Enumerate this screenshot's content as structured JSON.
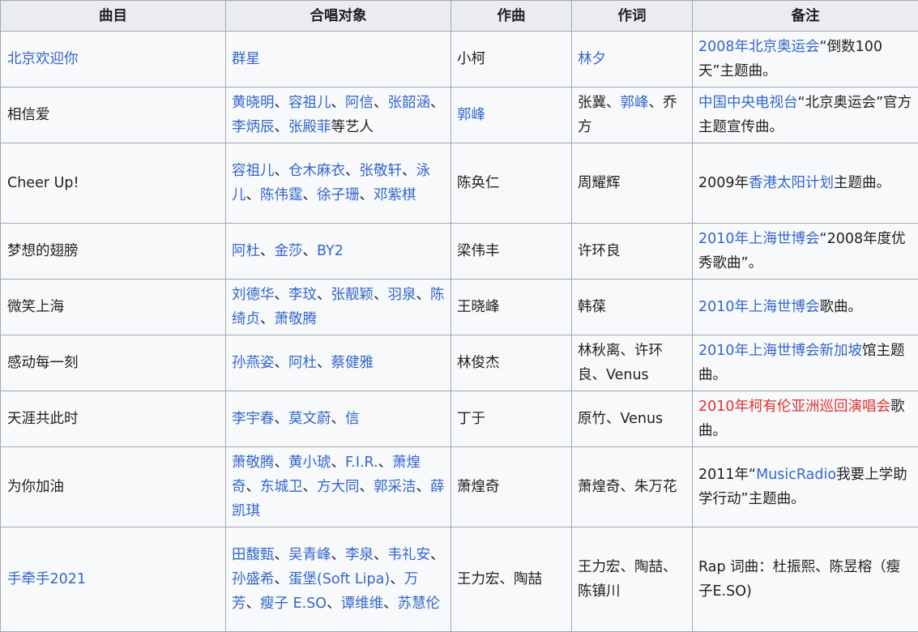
{
  "table": {
    "headers": [
      "曲目",
      "合唱对象",
      "作曲",
      "作词",
      "备注"
    ],
    "rows": [
      {
        "title": [
          {
            "t": "北京欢迎你",
            "link": true
          }
        ],
        "singers": [
          {
            "t": "群星",
            "link": true
          }
        ],
        "composer": [
          {
            "t": "小柯"
          }
        ],
        "lyricist": [
          {
            "t": "林夕",
            "link": true
          }
        ],
        "note": [
          {
            "t": "2008年北京奥运会",
            "link": true
          },
          {
            "t": "“倒数100天”主题曲。"
          }
        ]
      },
      {
        "title": [
          {
            "t": "相信爱"
          }
        ],
        "singers": [
          {
            "t": "黄晓明",
            "link": true
          },
          {
            "t": "、"
          },
          {
            "t": "容祖儿",
            "link": true
          },
          {
            "t": "、"
          },
          {
            "t": "阿信",
            "link": true
          },
          {
            "t": "、"
          },
          {
            "t": "张韶涵",
            "link": true
          },
          {
            "t": "、"
          },
          {
            "t": "李炳辰",
            "link": true
          },
          {
            "t": "、"
          },
          {
            "t": "张殿菲",
            "link": true
          },
          {
            "t": "等艺人"
          }
        ],
        "composer": [
          {
            "t": "郭峰",
            "link": true
          }
        ],
        "lyricist": [
          {
            "t": "张冀、"
          },
          {
            "t": "郭峰",
            "link": true
          },
          {
            "t": "、乔方"
          }
        ],
        "note": [
          {
            "t": "中国中央电视台",
            "link": true
          },
          {
            "t": "“北京奥运会”官方主题宣传曲。"
          }
        ]
      },
      {
        "title": [
          {
            "t": "Cheer Up!"
          }
        ],
        "singers": [
          {
            "t": "容祖儿",
            "link": true
          },
          {
            "t": "、"
          },
          {
            "t": "仓木麻衣",
            "link": true
          },
          {
            "t": "、"
          },
          {
            "t": "张敬轩",
            "link": true
          },
          {
            "t": "、"
          },
          {
            "t": "泳儿",
            "link": true
          },
          {
            "t": "、"
          },
          {
            "t": "陈伟霆",
            "link": true
          },
          {
            "t": "、"
          },
          {
            "t": "徐子珊",
            "link": true
          },
          {
            "t": "、"
          },
          {
            "t": "邓紫棋",
            "link": true
          }
        ],
        "composer": [
          {
            "t": "陈奂仁"
          }
        ],
        "lyricist": [
          {
            "t": "周耀辉"
          }
        ],
        "note": [
          {
            "t": "2009年"
          },
          {
            "t": "香港太阳计划",
            "link": true
          },
          {
            "t": "主题曲。"
          }
        ]
      },
      {
        "title": [
          {
            "t": "梦想的翅膀"
          }
        ],
        "singers": [
          {
            "t": "阿杜",
            "link": true
          },
          {
            "t": "、"
          },
          {
            "t": "金莎",
            "link": true
          },
          {
            "t": "、"
          },
          {
            "t": "BY2",
            "link": true
          }
        ],
        "composer": [
          {
            "t": "梁伟丰"
          }
        ],
        "lyricist": [
          {
            "t": "许环良"
          }
        ],
        "note": [
          {
            "t": "2010年上海世博会",
            "link": true
          },
          {
            "t": "“2008年度优秀歌曲”。"
          }
        ]
      },
      {
        "title": [
          {
            "t": "微笑上海"
          }
        ],
        "singers": [
          {
            "t": "刘德华",
            "link": true
          },
          {
            "t": "、"
          },
          {
            "t": "李玟",
            "link": true
          },
          {
            "t": "、"
          },
          {
            "t": "张靓颖",
            "link": true
          },
          {
            "t": "、"
          },
          {
            "t": "羽泉",
            "link": true
          },
          {
            "t": "、"
          },
          {
            "t": "陈绮贞",
            "link": true
          },
          {
            "t": "、"
          },
          {
            "t": "萧敬腾",
            "link": true
          }
        ],
        "composer": [
          {
            "t": "王晓峰"
          }
        ],
        "lyricist": [
          {
            "t": "韩葆"
          }
        ],
        "note": [
          {
            "t": "2010年上海世博会",
            "link": true
          },
          {
            "t": "歌曲。"
          }
        ]
      },
      {
        "title": [
          {
            "t": "感动每一刻"
          }
        ],
        "singers": [
          {
            "t": "孙燕姿",
            "link": true
          },
          {
            "t": "、"
          },
          {
            "t": "阿杜",
            "link": true
          },
          {
            "t": "、"
          },
          {
            "t": "蔡健雅",
            "link": true
          }
        ],
        "composer": [
          {
            "t": "林俊杰"
          }
        ],
        "lyricist": [
          {
            "t": "林秋离、许环良、Venus"
          }
        ],
        "note": [
          {
            "t": "2010年上海世博会",
            "link": true
          },
          {
            "t": "新加坡",
            "link": true
          },
          {
            "t": "馆主题曲。"
          }
        ]
      },
      {
        "title": [
          {
            "t": "天涯共此时"
          }
        ],
        "singers": [
          {
            "t": "李宇春",
            "link": true
          },
          {
            "t": "、"
          },
          {
            "t": "莫文蔚",
            "link": true
          },
          {
            "t": "、"
          },
          {
            "t": "信",
            "link": true
          }
        ],
        "composer": [
          {
            "t": "丁于"
          }
        ],
        "lyricist": [
          {
            "t": "原竹、Venus"
          }
        ],
        "note": [
          {
            "t": "2010年柯有伦亚洲巡回演唱会",
            "red": true
          },
          {
            "t": "歌曲。"
          }
        ]
      },
      {
        "title": [
          {
            "t": "为你加油"
          }
        ],
        "singers": [
          {
            "t": "萧敬腾",
            "link": true
          },
          {
            "t": "、"
          },
          {
            "t": "黄小琥",
            "link": true
          },
          {
            "t": "、"
          },
          {
            "t": "F.I.R.",
            "link": true
          },
          {
            "t": "、"
          },
          {
            "t": "萧煌奇",
            "link": true
          },
          {
            "t": "、"
          },
          {
            "t": "东城卫",
            "link": true
          },
          {
            "t": "、"
          },
          {
            "t": "方大同",
            "link": true
          },
          {
            "t": "、"
          },
          {
            "t": "郭采洁",
            "link": true
          },
          {
            "t": "、"
          },
          {
            "t": "薛凯琪",
            "link": true
          }
        ],
        "composer": [
          {
            "t": "萧煌奇"
          }
        ],
        "lyricist": [
          {
            "t": "萧煌奇、朱万花"
          }
        ],
        "note": [
          {
            "t": "2011年“"
          },
          {
            "t": "MusicRadio",
            "link": true
          },
          {
            "t": "我要上学助学行动”主题曲。"
          }
        ]
      },
      {
        "title": [
          {
            "t": "手牵手2021",
            "link": true
          }
        ],
        "singers": [
          {
            "t": "田馥甄",
            "link": true
          },
          {
            "t": "、"
          },
          {
            "t": "吴青峰",
            "link": true
          },
          {
            "t": "、"
          },
          {
            "t": "李泉",
            "link": true
          },
          {
            "t": "、"
          },
          {
            "t": "韦礼安",
            "link": true
          },
          {
            "t": "、"
          },
          {
            "t": "孙盛希",
            "link": true
          },
          {
            "t": "、"
          },
          {
            "t": "蛋堡(Soft Lipa)",
            "link": true
          },
          {
            "t": "、"
          },
          {
            "t": "万芳",
            "link": true
          },
          {
            "t": "、"
          },
          {
            "t": "瘦子 E.SO",
            "link": true
          },
          {
            "t": "、"
          },
          {
            "t": "谭维维",
            "link": true
          },
          {
            "t": "、"
          },
          {
            "t": "苏慧伦",
            "link": true
          }
        ],
        "composer": [
          {
            "t": "王力宏、陶喆"
          }
        ],
        "lyricist": [
          {
            "t": "王力宏、陶喆、陈镇川"
          }
        ],
        "note": [
          {
            "t": "Rap 词曲：杜振熙、陈昱榕（瘦子E.SO)"
          }
        ]
      }
    ]
  },
  "colors": {
    "link": "#3366cc",
    "redlink": "#dd3333",
    "text": "#202122",
    "header_bg": "#eaecf0",
    "cell_bg": "#f8f9fa",
    "border": "#a2a9b1"
  }
}
